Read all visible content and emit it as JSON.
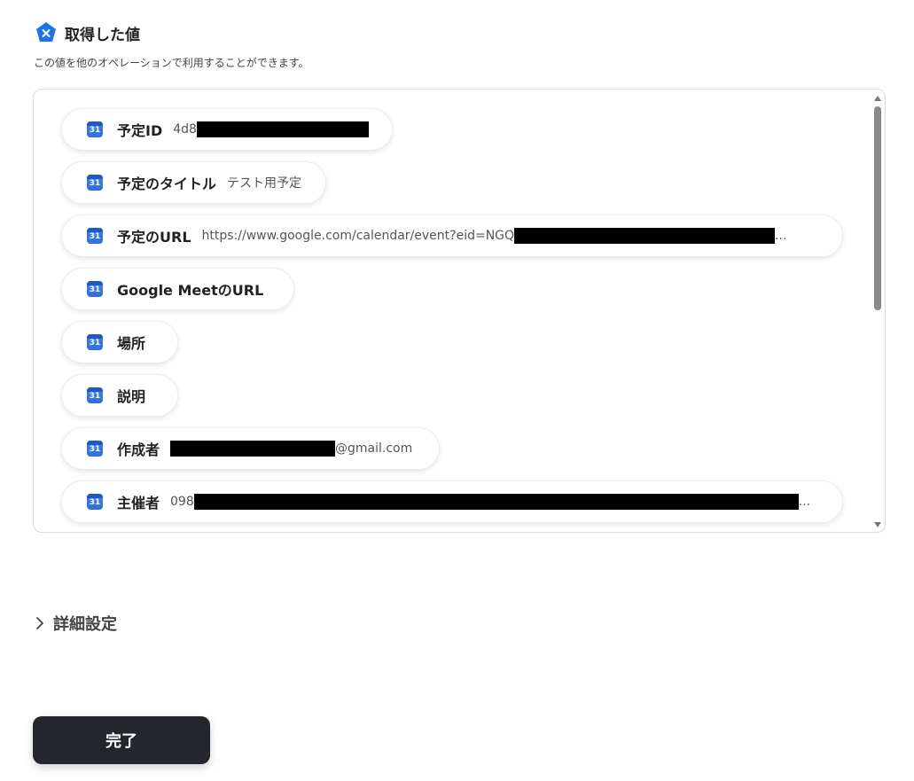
{
  "header": {
    "title": "取得した値",
    "subtitle": "この値を他のオペレーションで利用することができます。",
    "icon": "x-badge-icon",
    "accent_color": "#1a73e8"
  },
  "values_list": {
    "items": [
      {
        "label": "予定ID",
        "value": "4d8",
        "icon": "calendar-icon",
        "redacted": true
      },
      {
        "label": "予定のタイトル",
        "value": "テスト用予定",
        "icon": "calendar-icon"
      },
      {
        "label": "予定のURL",
        "value": "https://www.google.com/calendar/event?eid=NGQ",
        "tail": "...",
        "icon": "calendar-icon",
        "redacted": true
      },
      {
        "label": "Google MeetのURL",
        "value": "",
        "icon": "calendar-icon"
      },
      {
        "label": "場所",
        "value": "",
        "icon": "calendar-icon"
      },
      {
        "label": "説明",
        "value": "",
        "icon": "calendar-icon"
      },
      {
        "label": "作成者",
        "value": "",
        "tail": "@gmail.com",
        "icon": "calendar-icon",
        "redacted": true
      },
      {
        "label": "主催者",
        "value": "098",
        "tail": "...",
        "icon": "calendar-icon",
        "redacted": true
      }
    ],
    "calendar_icon_text": "31"
  },
  "details": {
    "label": "詳細設定",
    "icon": "chevron-right-icon"
  },
  "footer": {
    "done_label": "完了"
  }
}
